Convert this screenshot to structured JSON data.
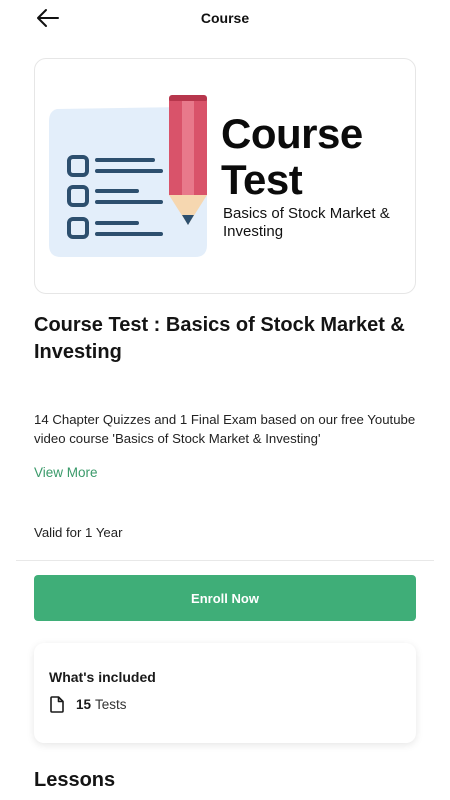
{
  "header": {
    "title": "Course",
    "back_icon": "arrow-left-icon"
  },
  "thumbnail": {
    "heading_line1": "Course",
    "heading_line2": "Test",
    "subtitle": "Basics of Stock Market & Investing",
    "illustration": "checklist-and-pencil-illustration"
  },
  "course": {
    "title": "Course Test : Basics of Stock Market & Investing",
    "description": "14 Chapter Quizzes and 1 Final Exam based on our free Youtube video course 'Basics of Stock Market & Investing'",
    "view_more": "View More",
    "validity": "Valid for 1 Year"
  },
  "enroll": {
    "label": "Enroll Now",
    "color": "#3fae78"
  },
  "included": {
    "title": "What's included",
    "icon": "document-icon",
    "count": "15",
    "label": "Tests"
  },
  "lessons": {
    "heading": "Lessons"
  },
  "colors": {
    "accent_green": "#3fae78",
    "link_green": "#3a9a6a",
    "pencil_red": "#d9536a",
    "paper_blue": "#e3eefa",
    "list_navy": "#2d4f6e"
  }
}
